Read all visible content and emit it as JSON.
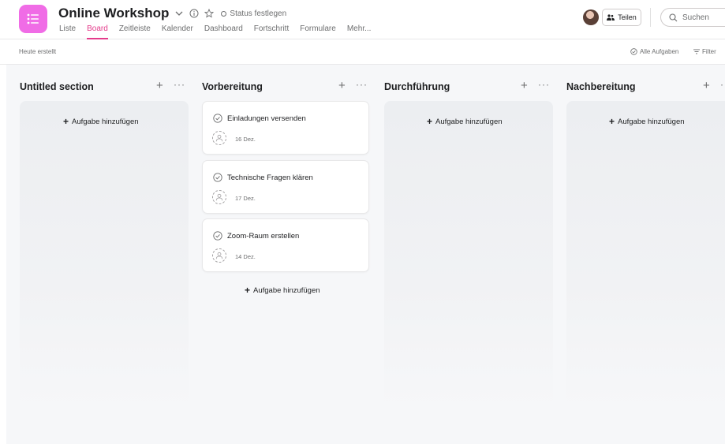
{
  "header": {
    "project_title": "Online Workshop",
    "status_label": "Status festlegen",
    "tabs": [
      {
        "label": "Liste",
        "active": false
      },
      {
        "label": "Board",
        "active": true
      },
      {
        "label": "Zeitleiste",
        "active": false
      },
      {
        "label": "Kalender",
        "active": false
      },
      {
        "label": "Dashboard",
        "active": false
      },
      {
        "label": "Fortschritt",
        "active": false
      },
      {
        "label": "Formulare",
        "active": false
      },
      {
        "label": "Mehr...",
        "active": false
      }
    ],
    "share_label": "Teilen",
    "search_placeholder": "Suchen"
  },
  "toolbar": {
    "created_label": "Heute erstellt",
    "all_tasks_label": "Alle Aufgaben",
    "filter_label": "Filter"
  },
  "board": {
    "add_task_label": "Aufgabe hinzufügen",
    "columns": [
      {
        "title": "Untitled section",
        "cards": []
      },
      {
        "title": "Vorbereitung",
        "cards": [
          {
            "name": "Einladungen versenden",
            "due": "16 Dez."
          },
          {
            "name": "Technische Fragen klären",
            "due": "17 Dez."
          },
          {
            "name": "Zoom-Raum erstellen",
            "due": "14 Dez."
          }
        ]
      },
      {
        "title": "Durchführung",
        "cards": []
      },
      {
        "title": "Nachbereitung",
        "cards": []
      }
    ]
  },
  "colors": {
    "accent": "#e43b8b",
    "app_icon": "#f06ce6",
    "board_bg": "#f6f7f9",
    "text_secondary": "#6d6e6f"
  },
  "icons": {
    "app": "list-icon",
    "title_chevron": "chevron-down-icon",
    "info": "info-icon",
    "favorite": "star-icon",
    "share": "people-icon",
    "search": "search-icon",
    "all_tasks": "check-circle-icon",
    "filter": "filter-icon",
    "add": "plus-icon",
    "more": "more-icon",
    "task_check": "check-circle-icon",
    "assignee": "user-icon"
  }
}
